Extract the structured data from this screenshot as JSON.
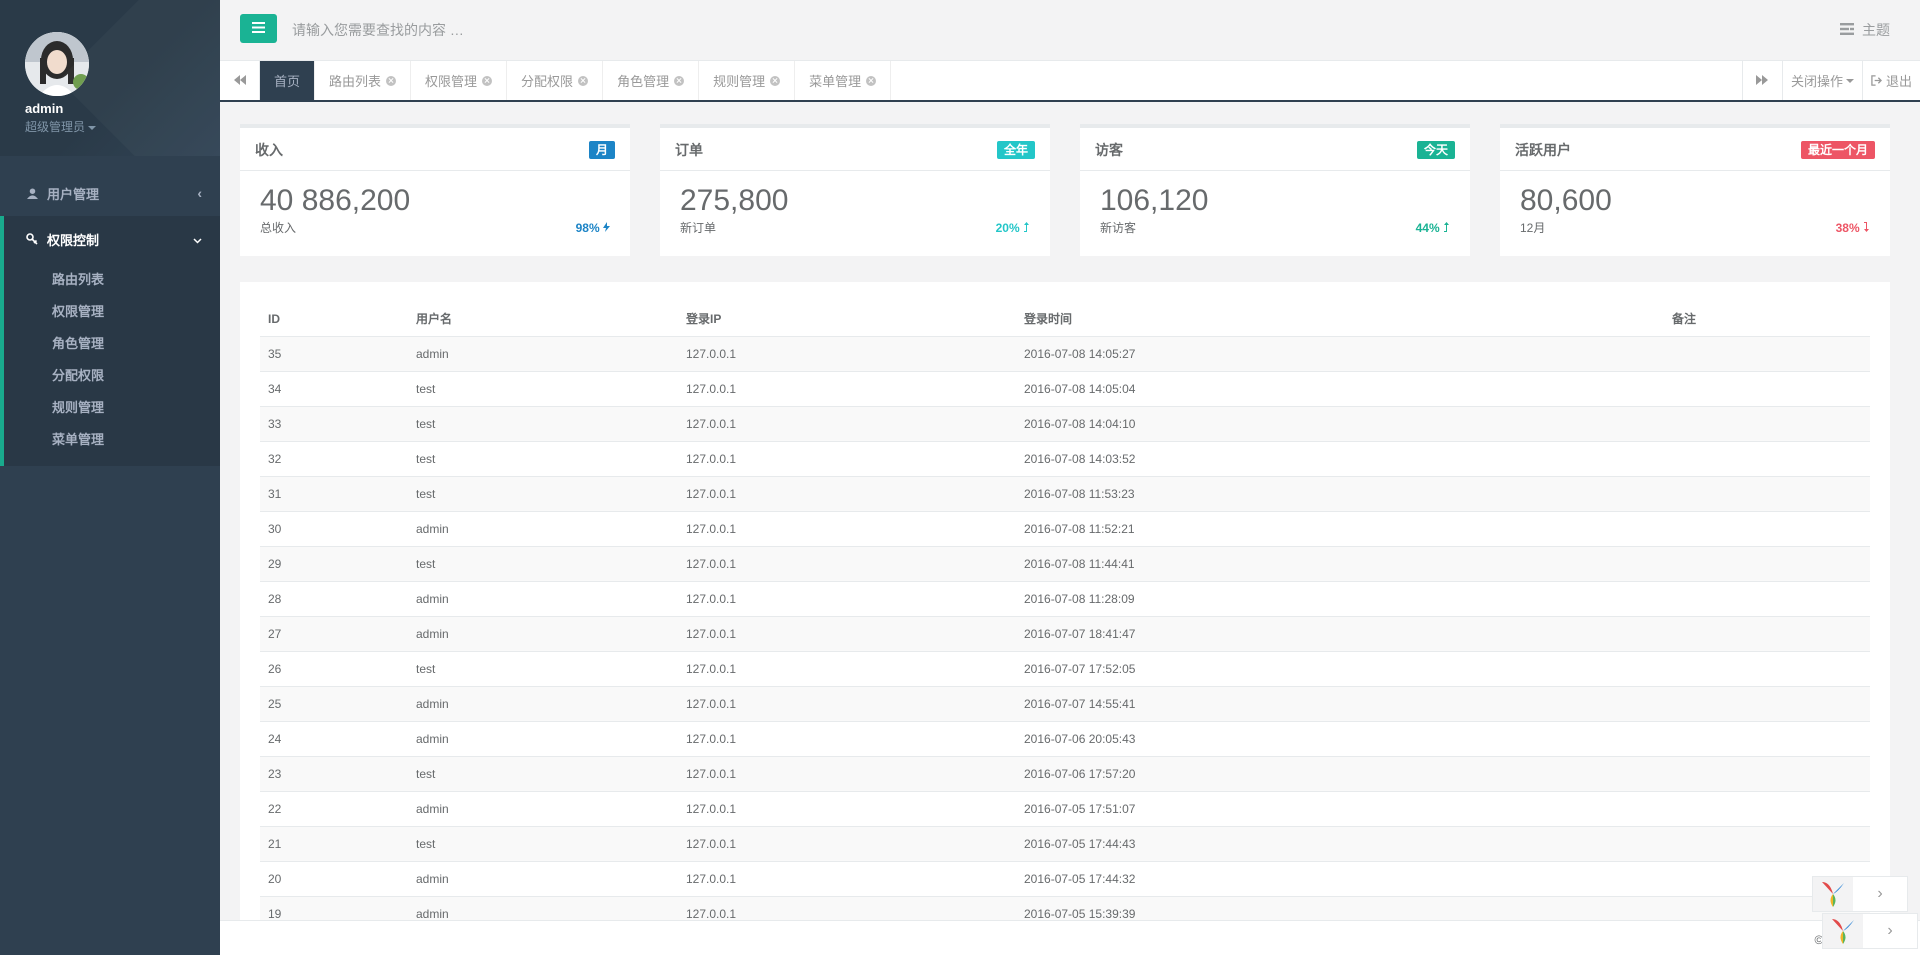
{
  "profile": {
    "name": "admin",
    "role": "超级管理员"
  },
  "sidebar": {
    "items": [
      {
        "label": "用户管理",
        "icon": "user-icon"
      },
      {
        "label": "权限控制",
        "icon": "key-icon"
      }
    ],
    "sub_items": [
      "路由列表",
      "权限管理",
      "角色管理",
      "分配权限",
      "规则管理",
      "菜单管理"
    ]
  },
  "topbar": {
    "search_placeholder": "请输入您需要查找的内容 …",
    "theme_label": "主题"
  },
  "tabs": {
    "items": [
      {
        "label": "首页",
        "active": true
      },
      {
        "label": "路由列表"
      },
      {
        "label": "权限管理"
      },
      {
        "label": "分配权限"
      },
      {
        "label": "角色管理"
      },
      {
        "label": "规则管理"
      },
      {
        "label": "菜单管理"
      }
    ],
    "close_ops_label": "关闭操作",
    "logout_label": "退出"
  },
  "cards": [
    {
      "title": "收入",
      "badge": "月",
      "badge_color": "#1c84c6",
      "value": "40 886,200",
      "sub": "总收入",
      "stat": "98%",
      "stat_color": "#1c84c6",
      "stat_icon": "bolt-icon"
    },
    {
      "title": "订单",
      "badge": "全年",
      "badge_color": "#23c6c8",
      "value": "275,800",
      "sub": "新订单",
      "stat": "20%",
      "stat_color": "#23c6c8",
      "stat_icon": "level-up-icon"
    },
    {
      "title": "访客",
      "badge": "今天",
      "badge_color": "#1ab394",
      "value": "106,120",
      "sub": "新访客",
      "stat": "44%",
      "stat_color": "#1ab394",
      "stat_icon": "level-up-icon"
    },
    {
      "title": "活跃用户",
      "badge": "最近一个月",
      "badge_color": "#ed5565",
      "value": "80,600",
      "sub": "12月",
      "stat": "38%",
      "stat_color": "#ed5565",
      "stat_icon": "level-down-icon"
    }
  ],
  "table": {
    "columns": [
      "ID",
      "用户名",
      "登录IP",
      "登录时间",
      "备注"
    ],
    "rows": [
      [
        "35",
        "admin",
        "127.0.0.1",
        "2016-07-08 14:05:27",
        ""
      ],
      [
        "34",
        "test",
        "127.0.0.1",
        "2016-07-08 14:05:04",
        ""
      ],
      [
        "33",
        "test",
        "127.0.0.1",
        "2016-07-08 14:04:10",
        ""
      ],
      [
        "32",
        "test",
        "127.0.0.1",
        "2016-07-08 14:03:52",
        ""
      ],
      [
        "31",
        "test",
        "127.0.0.1",
        "2016-07-08 11:53:23",
        ""
      ],
      [
        "30",
        "admin",
        "127.0.0.1",
        "2016-07-08 11:52:21",
        ""
      ],
      [
        "29",
        "test",
        "127.0.0.1",
        "2016-07-08 11:44:41",
        ""
      ],
      [
        "28",
        "admin",
        "127.0.0.1",
        "2016-07-08 11:28:09",
        ""
      ],
      [
        "27",
        "admin",
        "127.0.0.1",
        "2016-07-07 18:41:47",
        ""
      ],
      [
        "26",
        "test",
        "127.0.0.1",
        "2016-07-07 17:52:05",
        ""
      ],
      [
        "25",
        "admin",
        "127.0.0.1",
        "2016-07-07 14:55:41",
        ""
      ],
      [
        "24",
        "admin",
        "127.0.0.1",
        "2016-07-06 20:05:43",
        ""
      ],
      [
        "23",
        "test",
        "127.0.0.1",
        "2016-07-06 17:57:20",
        ""
      ],
      [
        "22",
        "admin",
        "127.0.0.1",
        "2016-07-05 17:51:07",
        ""
      ],
      [
        "21",
        "test",
        "127.0.0.1",
        "2016-07-05 17:44:43",
        ""
      ],
      [
        "20",
        "admin",
        "127.0.0.1",
        "2016-07-05 17:44:32",
        ""
      ],
      [
        "19",
        "admin",
        "127.0.0.1",
        "2016-07-05 15:39:39",
        ""
      ]
    ]
  },
  "footer": {
    "text": "© 20"
  },
  "colors": {
    "sidebar_bg": "#2f4050",
    "accent": "#1ab394"
  }
}
